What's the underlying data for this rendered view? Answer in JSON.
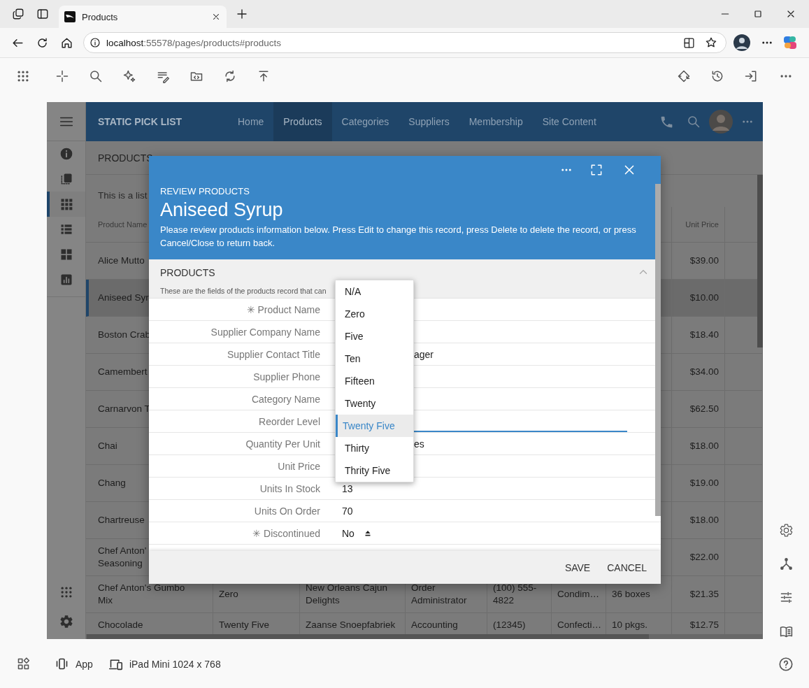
{
  "browser": {
    "tab_title": "Products",
    "url_host": "localhost",
    "url_rest": ":55578/pages/products#products"
  },
  "app": {
    "brand": "STATIC PICK LIST",
    "nav": [
      {
        "label": "Home",
        "selected": false
      },
      {
        "label": "Products",
        "selected": true
      },
      {
        "label": "Categories",
        "selected": false
      },
      {
        "label": "Suppliers",
        "selected": false
      },
      {
        "label": "Membership",
        "selected": false
      },
      {
        "label": "Site Content",
        "selected": false
      }
    ],
    "rail": [
      {
        "selected": false
      },
      {
        "selected": false
      },
      {
        "selected": true
      },
      {
        "selected": false
      },
      {
        "selected": false
      },
      {
        "selected": false
      }
    ],
    "page_title": "PRODUCTS",
    "page_description": "This is a list",
    "table": {
      "columns": [
        {
          "label": "Product Name"
        },
        {
          "label": "Unit Price"
        }
      ],
      "rows": [
        {
          "product_name": "Alice Mutto",
          "unit_price": "$39.00",
          "selected": false
        },
        {
          "product_name": "Aniseed Syr",
          "unit_price": "$10.00",
          "selected": true
        },
        {
          "product_name": "Boston Crab",
          "unit_price": "$18.40",
          "selected": false
        },
        {
          "product_name": "Camembert",
          "unit_price": "$34.00",
          "selected": false
        },
        {
          "product_name": "Carnarvon T",
          "unit_price": "$62.50",
          "selected": false
        },
        {
          "product_name": "Chai",
          "unit_price": "$18.00",
          "selected": false
        },
        {
          "product_name": "Chang",
          "unit_price": "$19.00",
          "selected": false
        },
        {
          "product_name": "Chartreuse",
          "unit_price": "$18.00",
          "selected": false
        },
        {
          "product_name": "Chef Anton'\nSeasoning",
          "unit_price": "$22.00",
          "selected": false
        },
        {
          "product_name": "Chef Anton's Gumbo\nMix",
          "column_2": "Zero",
          "column_3": "New Orleans Cajun\nDelights",
          "column_4": "Order\nAdministrator",
          "column_5": "(100) 555-\n4822",
          "column_6": "Condim…",
          "column_7": "36 boxes",
          "unit_price": "$21.35",
          "selected": false
        },
        {
          "product_name": "Chocolade",
          "column_2": "Twenty Five",
          "column_3": "Zaanse Snoepfabriek",
          "column_4": "Accounting",
          "column_5": "(12345)",
          "column_6": "Confecti…",
          "column_7": "10 pkgs.",
          "unit_price": "$12.75",
          "selected": false
        }
      ]
    }
  },
  "modal": {
    "eyebrow": "REVIEW PRODUCTS",
    "title": "Aniseed Syrup",
    "description": "Please review products information below. Press Edit to change this record, press Delete to delete the record, or press Cancel/Close to return back.",
    "section": {
      "title": "PRODUCTS",
      "description": "These are the fields of the products record that can",
      "expanded": true
    },
    "fields": [
      {
        "label": "✳ Product Name",
        "kind": "plain"
      },
      {
        "label": "Supplier Company Name",
        "kind": "plain"
      },
      {
        "label": "Supplier Contact Title",
        "kind": "behind-list",
        "value": "ager"
      },
      {
        "label": "Supplier Phone",
        "kind": "plain"
      },
      {
        "label": "Category Name",
        "kind": "plain"
      },
      {
        "label": "Reorder Level",
        "kind": "focused"
      },
      {
        "label": "Quantity Per Unit",
        "kind": "behind-list",
        "value": "es"
      },
      {
        "label": "Unit Price",
        "kind": "plain"
      },
      {
        "label": "Units In Stock",
        "kind": "plain",
        "value": "13"
      },
      {
        "label": "Units On Order",
        "kind": "plain",
        "value": "70"
      },
      {
        "label": "✳ Discontinued",
        "kind": "select",
        "value": "No"
      }
    ],
    "dropdown": [
      {
        "label": "N/A",
        "selected": false
      },
      {
        "label": "Zero",
        "selected": false
      },
      {
        "label": "Five",
        "selected": false
      },
      {
        "label": "Ten",
        "selected": false
      },
      {
        "label": "Fifteen",
        "selected": false
      },
      {
        "label": "Twenty",
        "selected": false
      },
      {
        "label": "Twenty Five",
        "selected": true
      },
      {
        "label": "Thirty",
        "selected": false
      },
      {
        "label": "Thrity Five",
        "selected": false
      }
    ],
    "buttons": [
      "SAVE",
      "CANCEL"
    ]
  },
  "bottom_bar": {
    "app_label": "App",
    "device_label": "iPad Mini 1024 x 768"
  }
}
